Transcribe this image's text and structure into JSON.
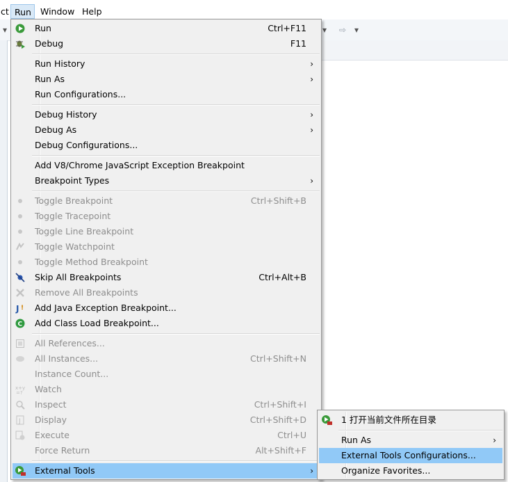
{
  "menubar": {
    "items": [
      "ct",
      "Run",
      "Window",
      "Help"
    ],
    "active": "Run"
  },
  "run_menu": {
    "groups": [
      [
        {
          "label": "Run",
          "shortcut": "Ctrl+F11",
          "icon": "run-icon",
          "enabled": true
        },
        {
          "label": "Debug",
          "shortcut": "F11",
          "icon": "debug-icon",
          "enabled": true
        }
      ],
      [
        {
          "label": "Run History",
          "submenu": true,
          "enabled": true
        },
        {
          "label": "Run As",
          "submenu": true,
          "enabled": true
        },
        {
          "label": "Run Configurations...",
          "enabled": true
        }
      ],
      [
        {
          "label": "Debug History",
          "submenu": true,
          "enabled": true
        },
        {
          "label": "Debug As",
          "submenu": true,
          "enabled": true
        },
        {
          "label": "Debug Configurations...",
          "enabled": true
        }
      ],
      [
        {
          "label": "Add V8/Chrome JavaScript Exception Breakpoint",
          "enabled": true
        },
        {
          "label": "Breakpoint Types",
          "submenu": true,
          "enabled": true
        }
      ],
      [
        {
          "label": "Toggle Breakpoint",
          "shortcut": "Ctrl+Shift+B",
          "icon": "breakpoint-dot-icon",
          "enabled": false
        },
        {
          "label": "Toggle Tracepoint",
          "icon": "breakpoint-dot-icon",
          "enabled": false
        },
        {
          "label": "Toggle Line Breakpoint",
          "icon": "breakpoint-dot-icon",
          "enabled": false
        },
        {
          "label": "Toggle Watchpoint",
          "icon": "watchpoint-icon",
          "enabled": false
        },
        {
          "label": "Toggle Method Breakpoint",
          "icon": "breakpoint-dot-icon",
          "enabled": false
        },
        {
          "label": "Skip All Breakpoints",
          "shortcut": "Ctrl+Alt+B",
          "icon": "skip-breakpoints-icon",
          "enabled": true
        },
        {
          "label": "Remove All Breakpoints",
          "icon": "remove-breakpoints-icon",
          "enabled": false
        },
        {
          "label": "Add Java Exception Breakpoint...",
          "icon": "java-exception-icon",
          "enabled": true
        },
        {
          "label": "Add Class Load Breakpoint...",
          "icon": "class-load-icon",
          "enabled": true
        }
      ],
      [
        {
          "label": "All References...",
          "icon": "references-icon",
          "enabled": false
        },
        {
          "label": "All Instances...",
          "shortcut": "Ctrl+Shift+N",
          "icon": "instances-icon",
          "enabled": false
        },
        {
          "label": "Instance Count...",
          "enabled": false
        },
        {
          "label": "Watch",
          "icon": "watch-icon",
          "enabled": false
        },
        {
          "label": "Inspect",
          "shortcut": "Ctrl+Shift+I",
          "icon": "inspect-icon",
          "enabled": false
        },
        {
          "label": "Display",
          "shortcut": "Ctrl+Shift+D",
          "icon": "display-icon",
          "enabled": false
        },
        {
          "label": "Execute",
          "shortcut": "Ctrl+U",
          "icon": "execute-icon",
          "enabled": false
        },
        {
          "label": "Force Return",
          "shortcut": "Alt+Shift+F",
          "enabled": false
        }
      ],
      [
        {
          "label": "External Tools",
          "submenu": true,
          "icon": "external-tools-icon",
          "enabled": true,
          "highlighted": true
        }
      ]
    ]
  },
  "external_tools_menu": {
    "groups": [
      [
        {
          "label": "1 打开当前文件所在目录",
          "icon": "external-tools-icon",
          "enabled": true
        }
      ],
      [
        {
          "label": "Run As",
          "submenu": true,
          "enabled": true
        },
        {
          "label": "External Tools Configurations...",
          "enabled": true,
          "highlighted": true
        },
        {
          "label": "Organize Favorites...",
          "enabled": true
        }
      ]
    ]
  },
  "colors": {
    "menu_bg": "#f0f0f0",
    "highlight": "#91c9f7",
    "disabled_text": "#8d8d8d",
    "run_green": "#3a9a3a"
  }
}
